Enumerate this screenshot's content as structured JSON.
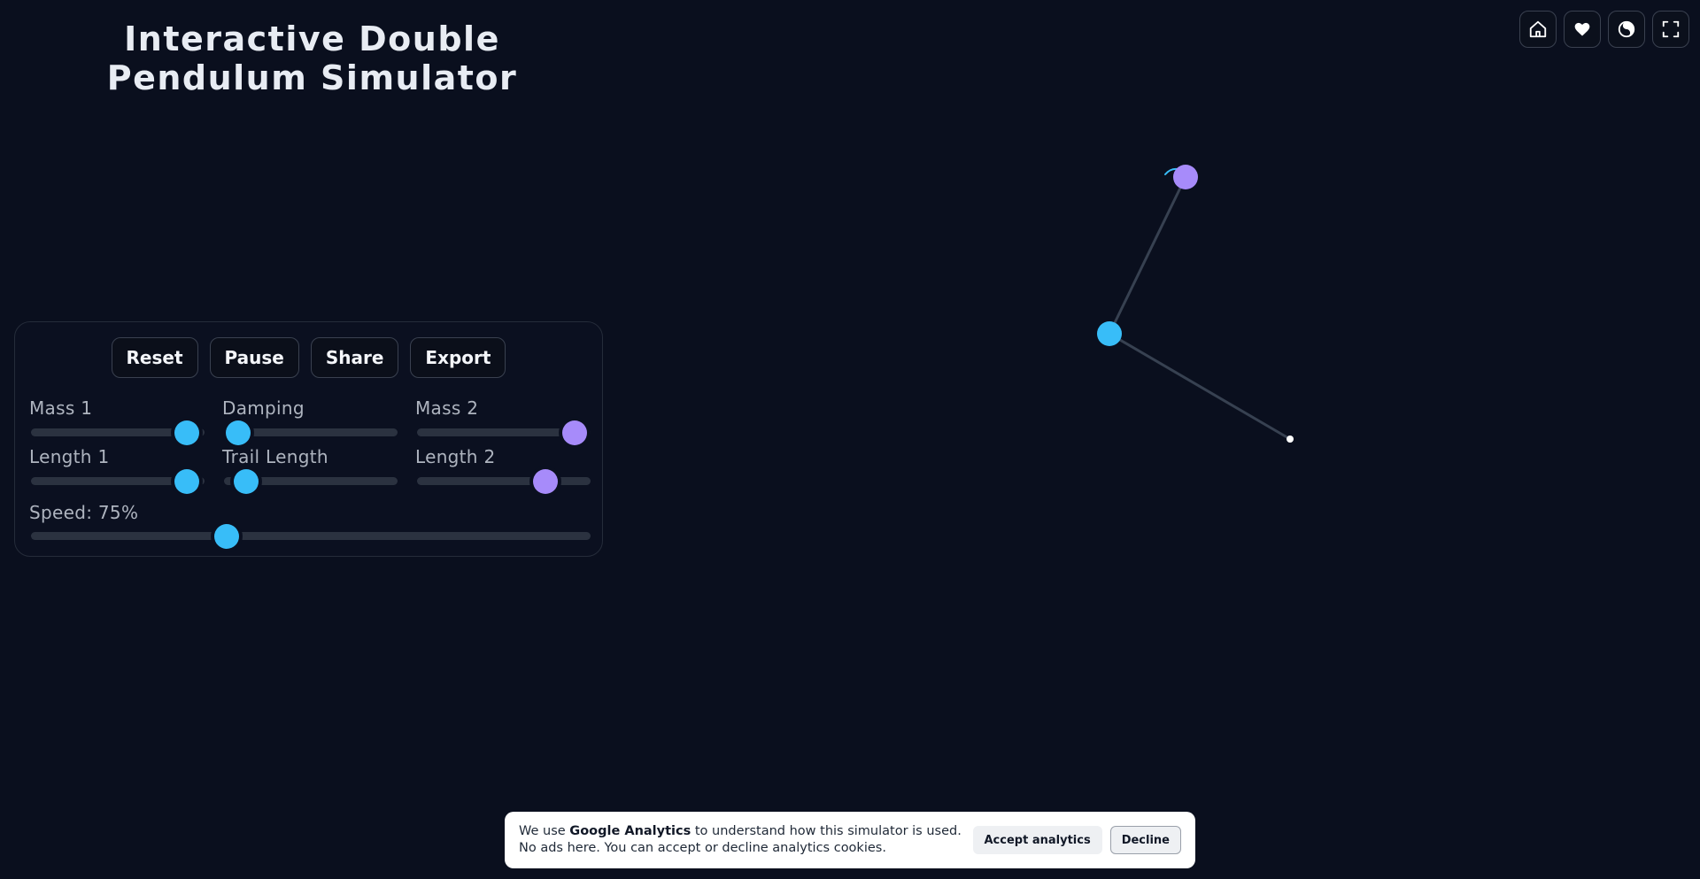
{
  "header": {
    "title_line1": "Interactive Double",
    "title_line2": "Pendulum Simulator"
  },
  "top_icons": [
    {
      "name": "home-icon"
    },
    {
      "name": "heart-icon"
    },
    {
      "name": "theme-icon"
    },
    {
      "name": "fullscreen-icon"
    }
  ],
  "controls": {
    "buttons": {
      "reset": "Reset",
      "pause": "Pause",
      "share": "Share",
      "export": "Export"
    },
    "sliders": {
      "mass1": {
        "label": "Mass 1",
        "fraction": 0.9,
        "color": "#38bdf8"
      },
      "damping": {
        "label": "Damping",
        "fraction": 0.08,
        "color": "#38bdf8"
      },
      "mass2": {
        "label": "Mass 2",
        "fraction": 0.91,
        "color": "#a78bfa"
      },
      "length1": {
        "label": "Length 1",
        "fraction": 0.9,
        "color": "#38bdf8"
      },
      "trail_length": {
        "label": "Trail Length",
        "fraction": 0.13,
        "color": "#38bdf8"
      },
      "length2": {
        "label": "Length 2",
        "fraction": 0.74,
        "color": "#a78bfa"
      },
      "speed": {
        "label": "Speed: 75%",
        "fraction": 0.35,
        "color": "#38bdf8"
      }
    }
  },
  "colors": {
    "background": "#0a0f1e",
    "mass1": "#38bdf8",
    "mass2": "#a78bfa"
  },
  "cookie_banner": {
    "text_before": "We use ",
    "text_bold": "Google Analytics",
    "text_after": " to understand how this simulator is used. No ads here. You can accept or decline analytics cookies.",
    "accept_label": "Accept analytics",
    "decline_label": "Decline"
  }
}
